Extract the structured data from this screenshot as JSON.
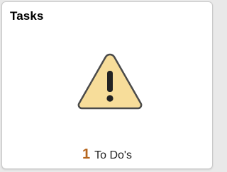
{
  "tile": {
    "title": "Tasks",
    "icon": "warning-icon",
    "count": "1",
    "count_label": "To Do's"
  },
  "colors": {
    "warning_fill": "#f7dd9a",
    "warning_stroke": "#4a4a4a",
    "count": "#b5651d"
  }
}
